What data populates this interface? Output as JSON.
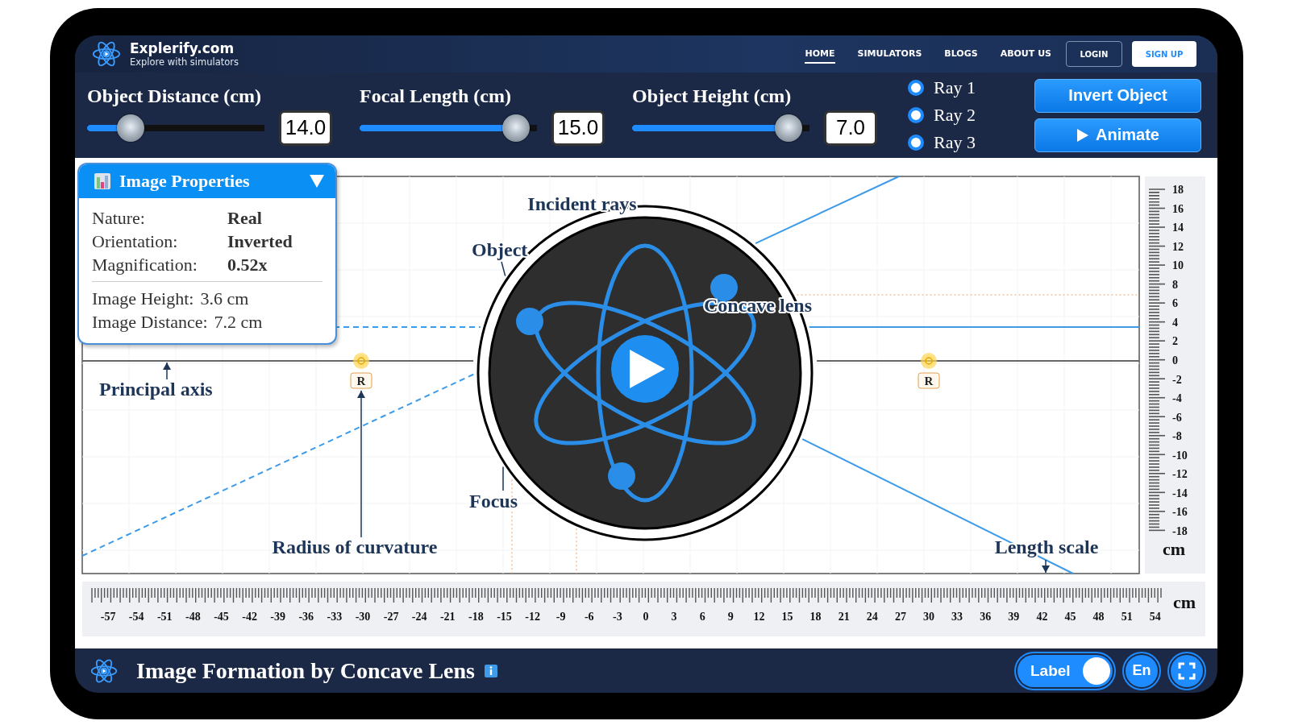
{
  "header": {
    "brand": "Explerify.com",
    "tagline": "Explore with simulators",
    "nav": [
      {
        "label": "HOME",
        "selected": true
      },
      {
        "label": "SIMULATORS",
        "selected": false
      },
      {
        "label": "BLOGS",
        "selected": false
      },
      {
        "label": "ABOUT US",
        "selected": false
      }
    ],
    "login": "LOGIN",
    "signup": "SIGN UP"
  },
  "controls": {
    "sliders": [
      {
        "label": "Object Distance (cm)",
        "value": "14.0",
        "level": 0.2
      },
      {
        "label": "Focal Length (cm)",
        "value": "15.0",
        "level": 0.95
      },
      {
        "label": "Object Height (cm)",
        "value": "7.0",
        "level": 0.95
      }
    ],
    "rays": [
      {
        "label": "Ray 1",
        "checked": true
      },
      {
        "label": "Ray 2",
        "checked": true
      },
      {
        "label": "Ray 3",
        "checked": true
      }
    ],
    "buttons": [
      {
        "label": "Invert Object",
        "kind": "plain"
      },
      {
        "label": "Animate",
        "kind": "play"
      }
    ]
  },
  "image_properties": {
    "title": "Image Properties",
    "rows": [
      {
        "label": "Nature:",
        "value": "Real"
      },
      {
        "label": "Orientation:",
        "value": "Inverted"
      },
      {
        "label": "Magnification:",
        "value": "0.52x"
      }
    ],
    "measurements": [
      {
        "label": "Image Height:",
        "value": "3.6 cm"
      },
      {
        "label": "Image Distance:",
        "value": "7.2 cm"
      }
    ]
  },
  "diagram": {
    "labels": [
      {
        "text": "Incident rays",
        "kind": "incident"
      },
      {
        "text": "Object",
        "kind": "object"
      },
      {
        "text": "Concave lens",
        "kind": "lens"
      },
      {
        "text": "Principal axis",
        "kind": "axis"
      },
      {
        "text": "Focus",
        "kind": "focus"
      },
      {
        "text": "Radius of curvature",
        "kind": "radius"
      },
      {
        "text": "Length scale",
        "kind": "scale"
      }
    ],
    "points": [
      "R",
      "R"
    ]
  },
  "vertical_scale": {
    "labels": [
      "18",
      "16",
      "14",
      "12",
      "10",
      "8",
      "6",
      "4",
      "2",
      "0",
      "-2",
      "-4",
      "-6",
      "-8",
      "-10",
      "-12",
      "-14",
      "-16",
      "-18"
    ],
    "unit": "cm"
  },
  "horizontal_scale": {
    "labels": [
      "-57",
      "-54",
      "-51",
      "-48",
      "-45",
      "-42",
      "-39",
      "-36",
      "-33",
      "-30",
      "-27",
      "-24",
      "-21",
      "-18",
      "-15",
      "-12",
      "-9",
      "-6",
      "-3",
      "0",
      "3",
      "6",
      "9",
      "12",
      "15",
      "18",
      "21",
      "24",
      "27",
      "30",
      "33",
      "36",
      "39",
      "42",
      "45",
      "48",
      "51",
      "54"
    ],
    "unit": "cm"
  },
  "footer": {
    "title": "Image Formation by Concave Lens",
    "toggle": {
      "label": "Label",
      "on": true
    },
    "language": "En"
  }
}
